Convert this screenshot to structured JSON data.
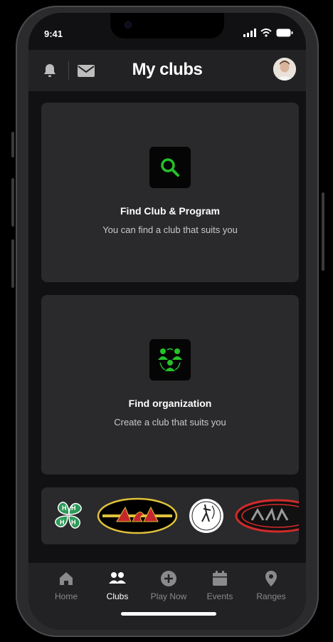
{
  "status": {
    "time": "9:41"
  },
  "header": {
    "title": "My clubs",
    "left_icons": [
      "bell-icon",
      "mail-icon"
    ],
    "avatar": "user-avatar"
  },
  "cards": [
    {
      "icon": "search-icon",
      "title": "Find Club & Program",
      "subtitle": "You can find a club that suits you"
    },
    {
      "icon": "group-icon",
      "title": "Find organization",
      "subtitle": "Create a club that suits you"
    }
  ],
  "logos": [
    "4h-clover-logo",
    "asa-logo",
    "circle-archer-logo",
    "red-oval-logo"
  ],
  "tabs": [
    {
      "label": "Home",
      "icon": "home-icon",
      "active": false
    },
    {
      "label": "Clubs",
      "icon": "people-icon",
      "active": true
    },
    {
      "label": "Play Now",
      "icon": "plus-circle-icon",
      "active": false
    },
    {
      "label": "Events",
      "icon": "calendar-icon",
      "active": false
    },
    {
      "label": "Ranges",
      "icon": "pin-icon",
      "active": false
    }
  ],
  "colors": {
    "accent": "#25c12a",
    "background": "#111113",
    "card": "#2a2a2c",
    "header": "#222224"
  }
}
